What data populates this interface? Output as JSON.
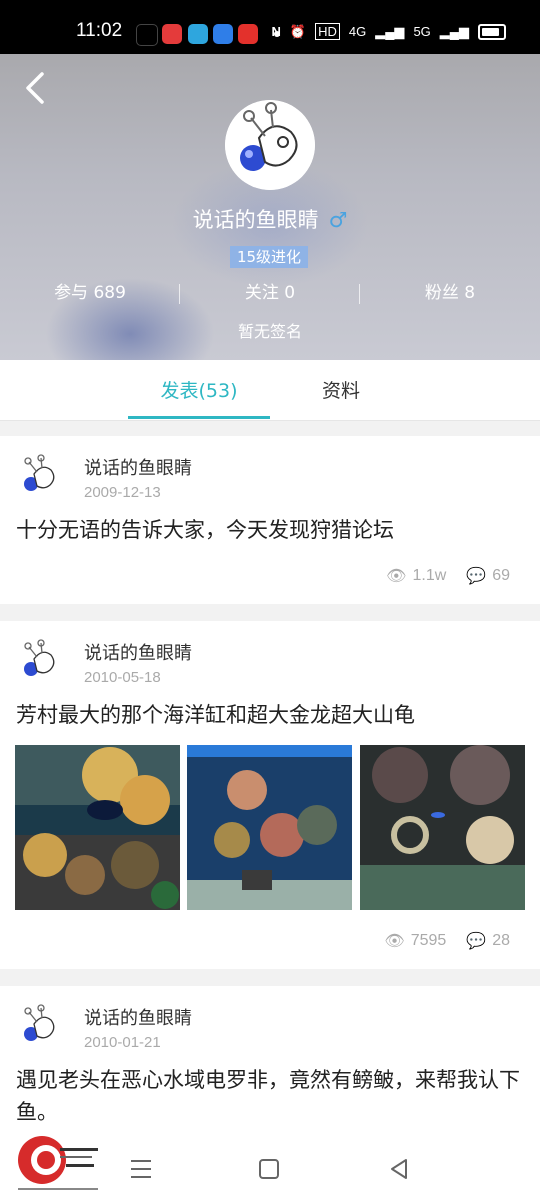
{
  "status_bar": {
    "time": "11:02",
    "network": "4G",
    "network2": "5G",
    "hd": "HD"
  },
  "profile": {
    "username": "说话的鱼眼睛",
    "gender_symbol": "♂",
    "level": "15级进化",
    "stats": [
      {
        "label": "参与 689"
      },
      {
        "label": "关注 0"
      },
      {
        "label": "粉丝 8"
      }
    ],
    "signature": "暂无签名"
  },
  "tabs": [
    {
      "label": "发表(53)",
      "active": true
    },
    {
      "label": "资料",
      "active": false
    }
  ],
  "posts": [
    {
      "author": "说话的鱼眼睛",
      "date": "2009-12-13",
      "title": "十分无语的告诉大家，今天发现狩猎论坛",
      "views": "1.1w",
      "comments": "69"
    },
    {
      "author": "说话的鱼眼睛",
      "date": "2010-05-18",
      "title": "芳村最大的那个海洋缸和超大金龙超大山龟",
      "views": "7595",
      "comments": "28"
    },
    {
      "author": "说话的鱼眼睛",
      "date": "2010-01-21",
      "title": "遇见老头在恶心水域电罗非，竟然有鳑鲏，来帮我认下鱼。"
    }
  ],
  "colors": {
    "accent": "#2eb7c3",
    "male": "#4aa3e0",
    "level_bg": "#8fb3e6"
  }
}
